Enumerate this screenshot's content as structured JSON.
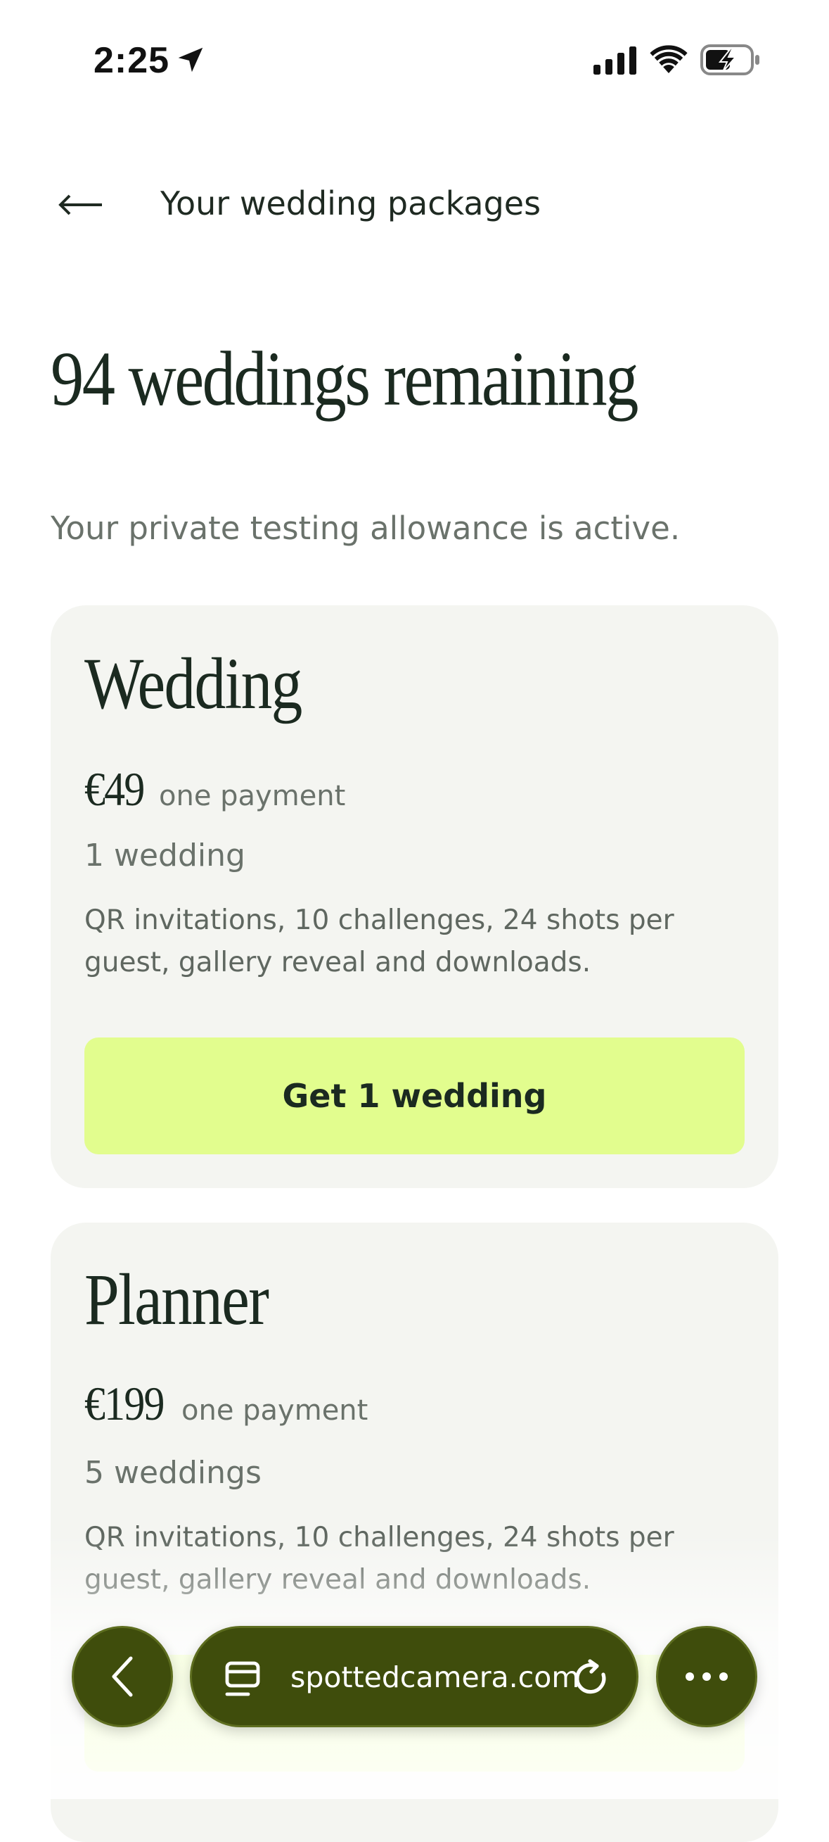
{
  "status_bar": {
    "time": "2:25"
  },
  "header": {
    "title": "Your wedding packages"
  },
  "page": {
    "title": "94 weddings remaining",
    "subtitle": "Your private testing allowance is active."
  },
  "packages": [
    {
      "name": "Wedding",
      "price": "€49",
      "price_note": "one payment",
      "quota": "1 wedding",
      "description": "QR invitations, 10 challenges, 24 shots per guest, gallery reveal and downloads.",
      "cta_label": "Get 1 wedding"
    },
    {
      "name": "Planner",
      "price": "€199",
      "price_note": "one payment",
      "quota": "5 weddings",
      "description": "QR invitations, 10 challenges, 24 shots per guest, gallery reveal and downloads.",
      "cta_label": ""
    }
  ],
  "browser_toolbar": {
    "url": "spottedcamera.com"
  },
  "colors": {
    "accent_button": "#e2fd8e",
    "card_background": "#f4f5f1",
    "toolbar": "#3f4d0c",
    "text_dark": "#1b2a20",
    "text_muted": "#6a726b"
  }
}
